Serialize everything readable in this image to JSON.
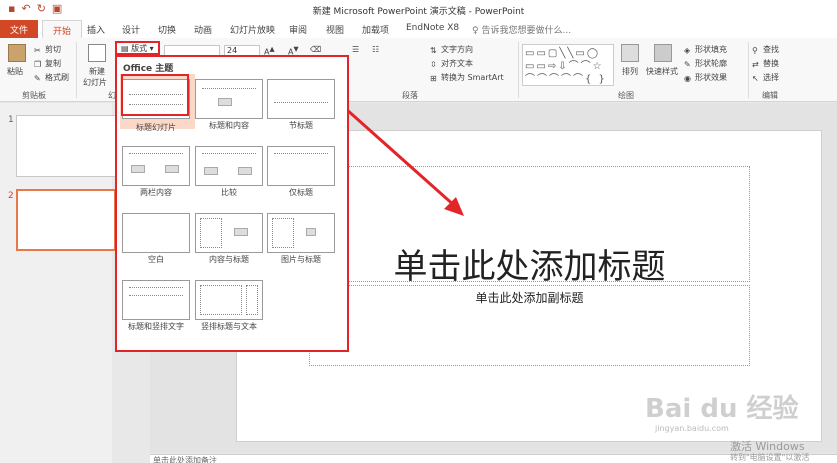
{
  "window": {
    "title": "新建 Microsoft PowerPoint 演示文稿 - PowerPoint"
  },
  "tabs": [
    "文件",
    "开始",
    "插入",
    "设计",
    "切换",
    "动画",
    "幻灯片放映",
    "审阅",
    "视图",
    "加载项",
    "EndNote X8"
  ],
  "tell_me": "告诉我您想要做什么...",
  "ribbon": {
    "clipboard": {
      "paste": "粘贴",
      "cut": "剪切",
      "copy": "复制",
      "format_painter": "格式刷",
      "label": "剪贴板"
    },
    "slides": {
      "new_slide_line1": "新建",
      "new_slide_line2": "幻灯片",
      "layout": "版式",
      "label": "幻"
    },
    "font_size": "24",
    "paragraph": {
      "text_direction": "文字方向",
      "align_text": "对齐文本",
      "smartart": "转换为 SmartArt",
      "label": "段落"
    },
    "drawing": {
      "arrange": "排列",
      "quick_styles": "快速样式",
      "shape_fill": "形状填充",
      "shape_outline": "形状轮廓",
      "shape_effects": "形状效果",
      "label": "绘图"
    },
    "editing": {
      "find": "查找",
      "replace": "替换",
      "select": "选择",
      "label": "编辑"
    }
  },
  "layout_gallery": {
    "header": "Office 主题",
    "items": [
      "标题幻灯片",
      "标题和内容",
      "节标题",
      "两栏内容",
      "比较",
      "仅标题",
      "空白",
      "内容与标题",
      "图片与标题",
      "标题和竖排文字",
      "竖排标题与文本"
    ]
  },
  "slides": {
    "numbers": [
      "1",
      "2"
    ]
  },
  "slide": {
    "title_placeholder": "单击此处添加标题",
    "subtitle_placeholder": "单击此处添加副标题"
  },
  "notes": "单击此处添加备注",
  "watermark": {
    "brand": "Bai du 经验",
    "url": "jingyan.baidu.com"
  },
  "activation": {
    "line1": "激活 Windows",
    "line2": "转到\"电脑设置\"以激活"
  },
  "colors": {
    "accent": "#d24726",
    "highlight": "#e3252a"
  }
}
